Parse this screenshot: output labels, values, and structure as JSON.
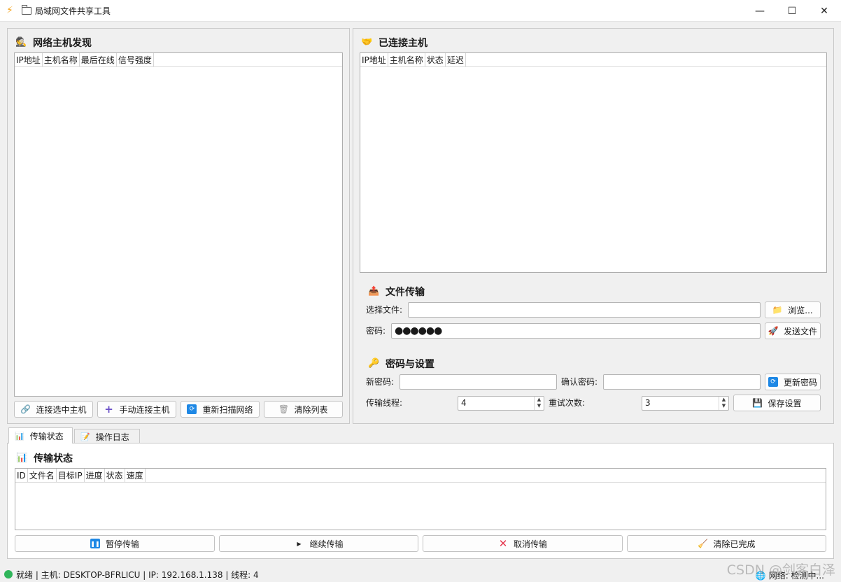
{
  "window": {
    "title": "局域网文件共享工具",
    "app_icon": "lightning-icon",
    "controls": {
      "minimize": "—",
      "maximize": "☐",
      "close": "✕"
    }
  },
  "discovery": {
    "title": "网络主机发现",
    "columns": [
      "IP地址",
      "主机名称",
      "最后在线",
      "信号强度"
    ],
    "rows": [],
    "buttons": {
      "connect_selected": "连接选中主机",
      "manual_connect": "手动连接主机",
      "rescan": "重新扫描网络",
      "clear_list": "清除列表"
    }
  },
  "connected": {
    "title": "已连接主机",
    "columns": [
      "IP地址",
      "主机名称",
      "状态",
      "延迟"
    ],
    "rows": []
  },
  "file_transfer": {
    "title": "文件传输",
    "select_file_label": "选择文件:",
    "select_file_value": "",
    "browse_label": "浏览...",
    "password_label": "密码:",
    "password_value": "●●●●●●",
    "send_label": "发送文件"
  },
  "settings": {
    "title": "密码与设置",
    "new_password_label": "新密码:",
    "new_password_value": "",
    "confirm_password_label": "确认密码:",
    "confirm_password_value": "",
    "update_password_label": "更新密码",
    "threads_label": "传输线程:",
    "threads_value": "4",
    "retries_label": "重试次数:",
    "retries_value": "3",
    "save_label": "保存设置"
  },
  "tabs": [
    {
      "label": "传输状态",
      "active": true
    },
    {
      "label": "操作日志",
      "active": false
    }
  ],
  "transfer_status": {
    "title": "传输状态",
    "columns": [
      "ID",
      "文件名",
      "目标IP",
      "进度",
      "状态",
      "速度"
    ],
    "rows": [],
    "buttons": {
      "pause": "暂停传输",
      "resume": "继续传输",
      "cancel": "取消传输",
      "clear_done": "清除已完成"
    }
  },
  "statusbar": {
    "text": "就绪 | 主机: DESKTOP-BFRLICU | IP: 192.168.1.138 | 线程: 4",
    "network": "网络: 检测中...",
    "indicator_color": "#2fb55a"
  },
  "watermark": "CSDN @剑客白泽"
}
